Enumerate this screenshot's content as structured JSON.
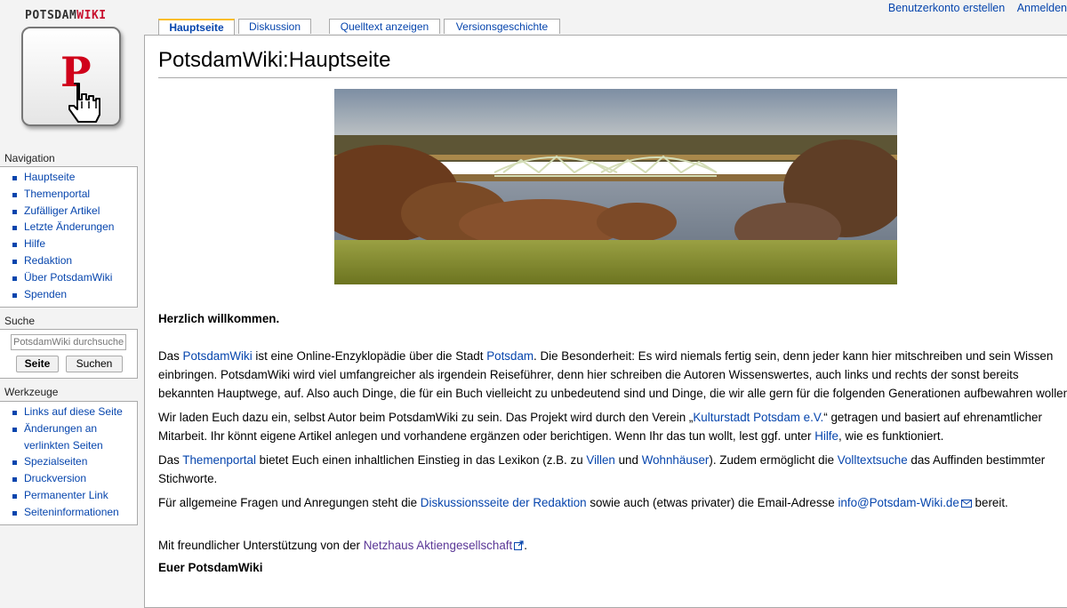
{
  "personal": {
    "create_account": "Benutzerkonto erstellen",
    "login": "Anmelden"
  },
  "logo": {
    "name_part1": "POTSDAM",
    "name_part2": "WIKI",
    "letter": "P"
  },
  "tabs": [
    {
      "label": "Hauptseite",
      "selected": true
    },
    {
      "label": "Diskussion",
      "selected": false
    },
    {
      "label": "Quelltext anzeigen",
      "selected": false
    },
    {
      "label": "Versionsgeschichte",
      "selected": false
    }
  ],
  "navigation": {
    "heading": "Navigation",
    "items": [
      "Hauptseite",
      "Themenportal",
      "Zufälliger Artikel",
      "Letzte Änderungen",
      "Hilfe",
      "Redaktion",
      "Über PotsdamWiki",
      "Spenden"
    ]
  },
  "search": {
    "heading": "Suche",
    "placeholder": "PotsdamWiki durchsuchen",
    "go_label": "Seite",
    "search_label": "Suchen"
  },
  "tools": {
    "heading": "Werkzeuge",
    "items": [
      "Links auf diese Seite",
      "Änderungen an verlinkten Seiten",
      "Spezialseiten",
      "Druckversion",
      "Permanenter Link",
      "Seiteninformationen"
    ]
  },
  "page": {
    "title": "PotsdamWiki:Hauptseite",
    "welcome": "Herzlich willkommen.",
    "p1": {
      "t1": "Das ",
      "l1": "PotsdamWiki",
      "t2": " ist eine Online-Enzyklopädie über die Stadt ",
      "l2": "Potsdam",
      "t3": ". Die Besonderheit: Es wird niemals fertig sein, denn jeder kann hier mitschreiben und sein Wissen einbringen. PotsdamWiki wird viel umfangreicher als irgendein Reiseführer, denn hier schreiben die Autoren Wissenswertes, auch links und rechts der sonst bereits bekannten Hauptwege, auf. Also auch Dinge, die für ein Buch vielleicht zu unbedeutend sind und Dinge, die wir alle gern für die folgenden Generationen aufbewahren wollen."
    },
    "p2": {
      "t1": "Wir laden Euch dazu ein, selbst Autor beim PotsdamWiki zu sein. Das Projekt wird durch den Verein „",
      "l1": "Kulturstadt Potsdam e.V.",
      "t2": "“ getragen und basiert auf ehrenamtlicher Mitarbeit. Ihr könnt eigene Artikel anlegen und vorhandene ergänzen oder berichtigen. Wenn Ihr das tun wollt, lest ggf. unter ",
      "l2": "Hilfe",
      "t3": ", wie es funktioniert."
    },
    "p3": {
      "t1": "Das ",
      "l1": "Themenportal",
      "t2": " bietet Euch einen inhaltlichen Einstieg in das Lexikon (z.B. zu ",
      "l2": "Villen",
      "t3": " und ",
      "l3": "Wohnhäuser",
      "t4": "). Zudem ermöglicht die ",
      "l4": "Volltextsuche",
      "t5": " das Auffinden bestimmter Stichworte."
    },
    "p4": {
      "t1": "Für allgemeine Fragen und Anregungen steht die ",
      "l1": "Diskussionsseite der Redaktion",
      "t2": " sowie auch (etwas privater) die Email-Adresse ",
      "l2": "info@Potsdam-Wiki.de",
      "t3": " bereit."
    },
    "p5": {
      "t1": "Mit freundlicher Unterstützung von der ",
      "l1": "Netzhaus Aktiengesellschaft",
      "t2": "."
    },
    "signature": "Euer PotsdamWiki"
  },
  "colors": {
    "link": "#0645ad",
    "visited": "#5a3696",
    "tab_accent": "#fabd23",
    "logo_red": "#c8102e"
  }
}
